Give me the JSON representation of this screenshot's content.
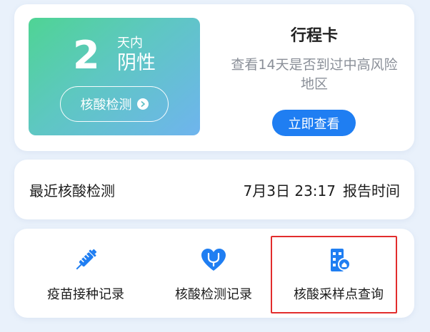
{
  "result": {
    "days": "2",
    "within_label": "天内",
    "status": "阴性",
    "test_button_label": "核酸检测"
  },
  "itinerary": {
    "title": "行程卡",
    "description": "查看14天是否到过中高风险地区",
    "button_label": "立即查看"
  },
  "recent_test": {
    "label": "最近核酸检测",
    "date_time": "7月3日 23:17",
    "report_label": "报告时间"
  },
  "actions": [
    {
      "label": "疫苗接种记录",
      "icon": "syringe-icon"
    },
    {
      "label": "核酸检测记录",
      "icon": "heart-stethoscope-icon"
    },
    {
      "label": "核酸采样点查询",
      "icon": "hospital-location-icon"
    }
  ],
  "colors": {
    "accent": "#1f7ef2",
    "highlight": "#e22d2d",
    "gradient_start": "#4fd494",
    "gradient_end": "#6fb4ee"
  }
}
